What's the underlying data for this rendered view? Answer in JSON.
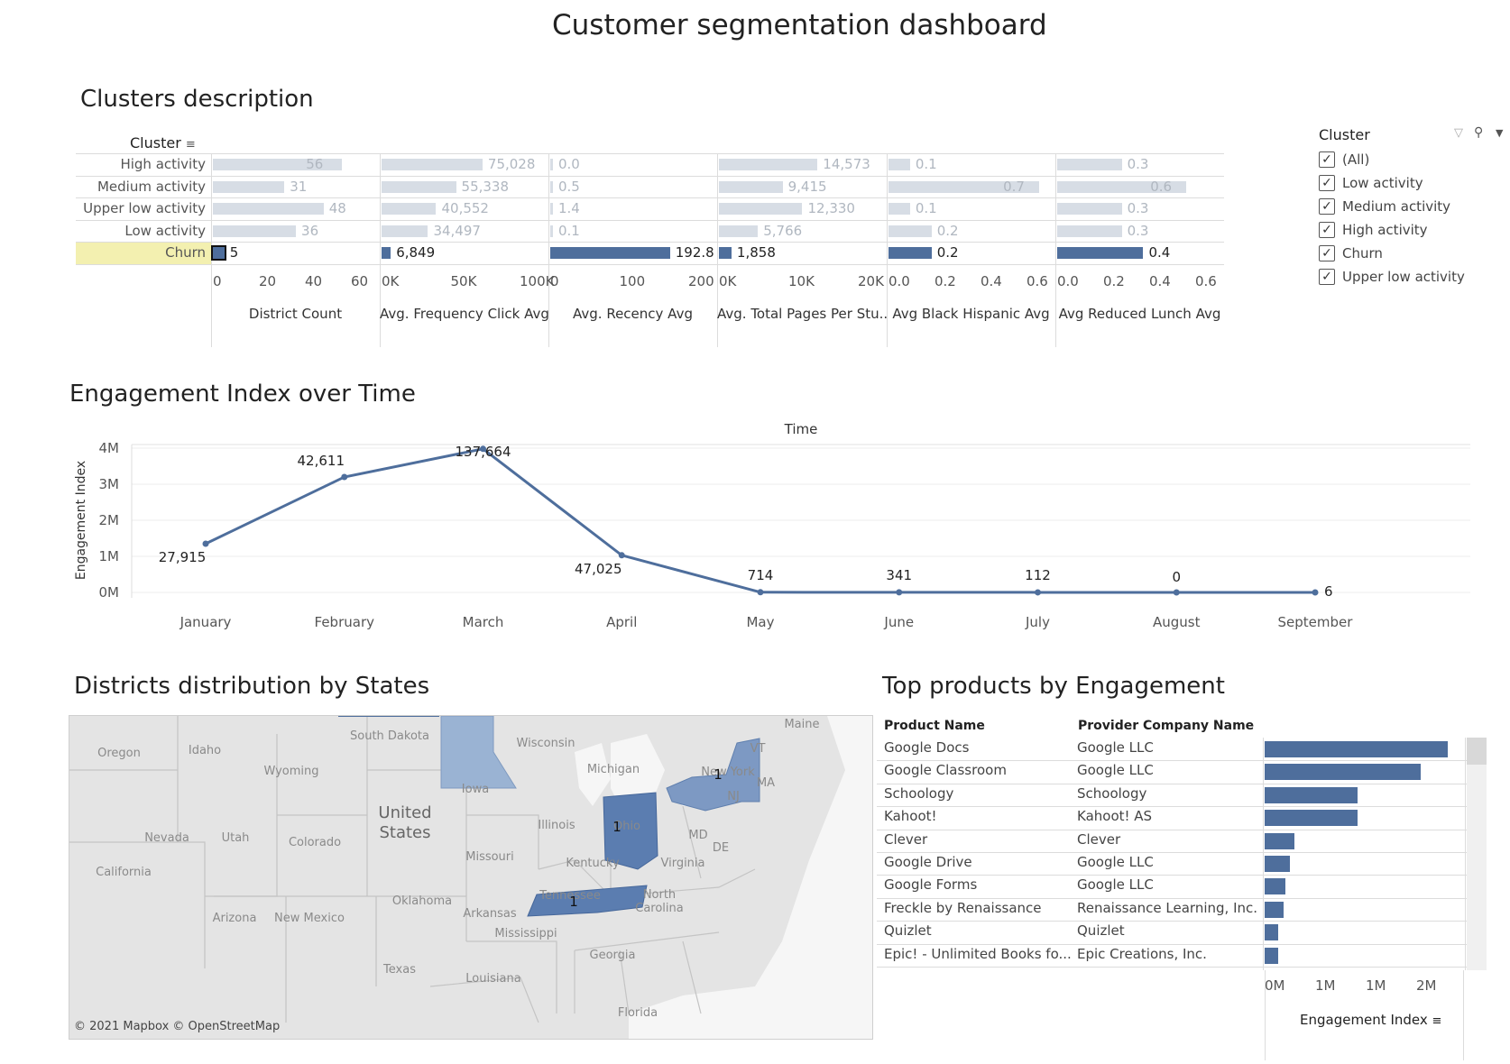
{
  "dashboard": {
    "title": "Customer segmentation dashboard"
  },
  "clusters": {
    "title": "Clusters description",
    "header": "Cluster",
    "rows": [
      {
        "label": "High activity",
        "values": [
          "56",
          "75,028",
          "0.0",
          "14,573",
          "0.1",
          "0.3"
        ]
      },
      {
        "label": "Medium activity",
        "values": [
          "31",
          "55,338",
          "0.5",
          "9,415",
          "0.7",
          "0.6"
        ]
      },
      {
        "label": "Upper low activity",
        "values": [
          "48",
          "40,552",
          "1.4",
          "12,330",
          "0.1",
          "0.3"
        ]
      },
      {
        "label": "Low activity",
        "values": [
          "36",
          "34,497",
          "0.1",
          "5,766",
          "0.2",
          "0.3"
        ]
      },
      {
        "label": "Churn",
        "values": [
          "5",
          "6,849",
          "192.8",
          "1,858",
          "0.2",
          "0.4"
        ]
      }
    ],
    "columns": [
      {
        "name": "District Count",
        "ticks": [
          "0",
          "20",
          "40",
          "60"
        ]
      },
      {
        "name": "Avg. Frequency Click Avg",
        "ticks": [
          "0K",
          "50K",
          "100K"
        ]
      },
      {
        "name": "Avg. Recency Avg",
        "ticks": [
          "0",
          "100",
          "200"
        ]
      },
      {
        "name": "Avg. Total Pages Per Stu...",
        "ticks": [
          "0K",
          "10K",
          "20K"
        ]
      },
      {
        "name": "Avg Black Hispanic Avg",
        "ticks": [
          "0.0",
          "0.2",
          "0.4",
          "0.6"
        ]
      },
      {
        "name": "Avg Reduced Lunch Avg",
        "ticks": [
          "0.0",
          "0.2",
          "0.4",
          "0.6"
        ]
      }
    ]
  },
  "filter": {
    "title": "Cluster",
    "options": [
      {
        "label": "(All)",
        "checked": true
      },
      {
        "label": "Low activity",
        "checked": true
      },
      {
        "label": "Medium activity",
        "checked": true
      },
      {
        "label": "High activity",
        "checked": true
      },
      {
        "label": "Churn",
        "checked": true
      },
      {
        "label": "Upper low activity",
        "checked": true
      }
    ]
  },
  "engagement": {
    "title": "Engagement Index over Time",
    "axis_title": "Time",
    "ylabel": "Engagement Index",
    "yticks": [
      "4M",
      "3M",
      "2M",
      "1M",
      "0M"
    ]
  },
  "districts": {
    "title": "Districts distribution by States",
    "labels": [
      "Oregon",
      "Idaho",
      "Wyoming",
      "South Dakota",
      "Wisconsin",
      "Michigan",
      "Iowa",
      "Nevada",
      "Utah",
      "Colorado",
      "United",
      "States",
      "Illinois",
      "Missouri",
      "Kentucky",
      "Virginia",
      "California",
      "Arizona",
      "New Mexico",
      "Oklahoma",
      "Arkansas",
      "Tennessee",
      "North",
      "Carolina",
      "Mississippi",
      "Georgia",
      "Texas",
      "Louisiana",
      "Florida",
      "Maine",
      "VT",
      "MA",
      "NJ",
      "MD",
      "DE",
      "New York",
      "Ohio"
    ],
    "state_counts": [
      "1",
      "1",
      "1",
      "1"
    ],
    "attribution": "© 2021 Mapbox  © OpenStreetMap"
  },
  "products": {
    "title": "Top products by Engagement",
    "col_product": "Product Name",
    "col_provider": "Provider Company Name",
    "axis_title": "Engagement Index",
    "xticks": [
      "0M",
      "1M",
      "1M",
      "2M"
    ],
    "rows": [
      {
        "product": "Google Docs",
        "provider": "Google LLC"
      },
      {
        "product": "Google Classroom",
        "provider": "Google LLC"
      },
      {
        "product": "Schoology",
        "provider": "Schoology"
      },
      {
        "product": "Kahoot!",
        "provider": "Kahoot! AS"
      },
      {
        "product": "Clever",
        "provider": "Clever"
      },
      {
        "product": "Google Drive",
        "provider": "Google LLC"
      },
      {
        "product": "Google Forms",
        "provider": "Google LLC"
      },
      {
        "product": "Freckle by Renaissance",
        "provider": "Renaissance Learning, Inc."
      },
      {
        "product": "Quizlet",
        "provider": "Quizlet"
      },
      {
        "product": "Epic! - Unlimited Books fo...",
        "provider": "Epic Creations, Inc."
      }
    ]
  },
  "chart_data": [
    {
      "type": "bar",
      "title": "Clusters description",
      "categories": [
        "High activity",
        "Medium activity",
        "Upper low activity",
        "Low activity",
        "Churn"
      ],
      "series": [
        {
          "name": "District Count",
          "values": [
            56,
            31,
            48,
            36,
            5
          ],
          "xlim": [
            0,
            70
          ]
        },
        {
          "name": "Avg. Frequency Click Avg",
          "values": [
            75028,
            55338,
            40552,
            34497,
            6849
          ],
          "xlim": [
            0,
            120000
          ]
        },
        {
          "name": "Avg. Recency Avg",
          "values": [
            0.0,
            0.5,
            1.4,
            0.1,
            192.8
          ],
          "xlim": [
            0,
            260
          ]
        },
        {
          "name": "Avg. Total Pages Per Stu...",
          "values": [
            14573,
            9415,
            12330,
            5766,
            1858
          ],
          "xlim": [
            0,
            24000
          ]
        },
        {
          "name": "Avg Black Hispanic Avg",
          "values": [
            0.1,
            0.7,
            0.1,
            0.2,
            0.2
          ],
          "xlim": [
            0,
            0.75
          ]
        },
        {
          "name": "Avg Reduced Lunch Avg",
          "values": [
            0.3,
            0.6,
            0.3,
            0.3,
            0.4
          ],
          "xlim": [
            0,
            0.75
          ]
        }
      ],
      "highlighted_category": "Churn"
    },
    {
      "type": "line",
      "title": "Engagement Index over Time",
      "xlabel": "Time",
      "ylabel": "Engagement Index",
      "x": [
        "January",
        "February",
        "March",
        "April",
        "May",
        "June",
        "July",
        "August",
        "September"
      ],
      "y": [
        1350000,
        3200000,
        3980000,
        1030000,
        5000,
        3000,
        1500,
        0,
        100
      ],
      "point_labels": [
        "27,915",
        "42,611",
        "137,664",
        "47,025",
        "714",
        "341",
        "112",
        "0",
        "6"
      ],
      "ylim": [
        0,
        4000000
      ],
      "color": "#4e6e9c"
    },
    {
      "type": "bar",
      "title": "Top products by Engagement",
      "xlabel": "Engagement Index",
      "categories": [
        "Google Docs",
        "Google Classroom",
        "Schoology",
        "Kahoot!",
        "Clever",
        "Google Drive",
        "Google Forms",
        "Freckle by Renaissance",
        "Quizlet",
        "Epic! - Unlimited Books fo..."
      ],
      "values": [
        2800000,
        2380000,
        1420000,
        1420000,
        460000,
        380000,
        310000,
        290000,
        210000,
        200000
      ],
      "xlim": [
        0,
        3000000
      ],
      "color": "#4e6e9c"
    }
  ]
}
